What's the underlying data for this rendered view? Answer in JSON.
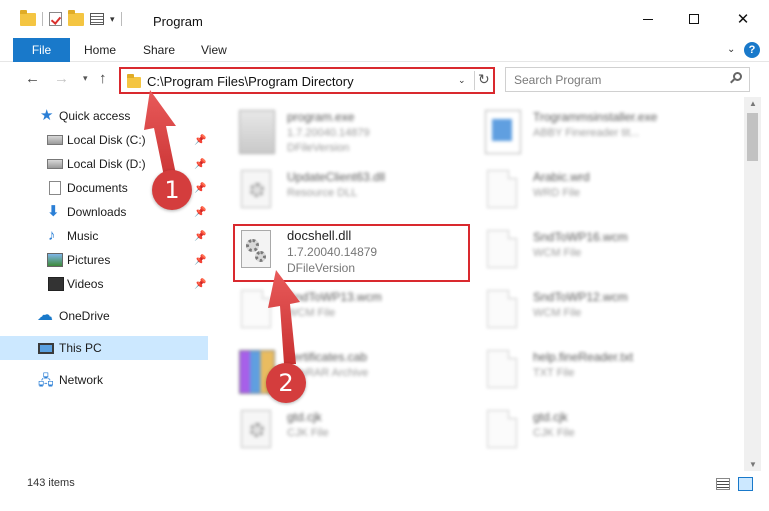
{
  "window": {
    "title": "Program",
    "minimize_label": "",
    "close_glyph": "✕"
  },
  "ribbon": {
    "tabs": [
      "File",
      "Home",
      "Share",
      "View"
    ],
    "help_label": "?",
    "expand_glyph": "⌄"
  },
  "nav": {
    "back_glyph": "←",
    "forward_glyph": "→",
    "recent_glyph": "▾",
    "up_glyph": "↑",
    "address": "C:\\Program Files\\Program Directory",
    "address_dropdown_glyph": "⌄",
    "refresh_glyph": "↻",
    "search_placeholder": "Search Program"
  },
  "sidebar": {
    "items": [
      {
        "label": "Quick access",
        "icon": "star-icon",
        "pinned": false
      },
      {
        "label": "Local Disk (C:)",
        "icon": "drive-icon",
        "pinned": true
      },
      {
        "label": "Local Disk (D:)",
        "icon": "drive-icon",
        "pinned": true
      },
      {
        "label": "Documents",
        "icon": "documents-icon",
        "pinned": true
      },
      {
        "label": "Downloads",
        "icon": "download-icon",
        "pinned": true
      },
      {
        "label": "Music",
        "icon": "music-icon",
        "pinned": true
      },
      {
        "label": "Pictures",
        "icon": "pictures-icon",
        "pinned": true
      },
      {
        "label": "Videos",
        "icon": "videos-icon",
        "pinned": true
      },
      {
        "label": "OneDrive",
        "icon": "cloud-icon",
        "pinned": false
      },
      {
        "label": "This PC",
        "icon": "computer-icon",
        "pinned": false,
        "selected": true
      },
      {
        "label": "Network",
        "icon": "network-icon",
        "pinned": false
      }
    ],
    "pin_glyph": "📌"
  },
  "files": [
    {
      "name": "program.exe",
      "line2": "1.7.20040.14879",
      "line3": "DFileVersion",
      "icon": "exe-icon",
      "blurred": true
    },
    {
      "name": "Trogrammsinstaller.exe",
      "line2": "ABBY Finereader tit...",
      "line3": "",
      "icon": "installer-icon",
      "blurred": true
    },
    {
      "name": "UpdateClient63.dll",
      "line2": "Resource DLL",
      "line3": "",
      "icon": "dll-icon",
      "blurred": true
    },
    {
      "name": "Arabic.wrd",
      "line2": "WRD File",
      "line3": "",
      "icon": "file-icon",
      "blurred": true
    },
    {
      "name": "docshell.dll",
      "line2": "1.7.20040.14879",
      "line3": "DFileVersion",
      "icon": "dll-icon",
      "blurred": false
    },
    {
      "name": "SndToWP16.wcm",
      "line2": "WCM File",
      "line3": "",
      "icon": "file-icon",
      "blurred": true
    },
    {
      "name": "SndToWP13.wcm",
      "line2": "WCM File",
      "line3": "",
      "icon": "file-icon",
      "blurred": true
    },
    {
      "name": "SndToWP12.wcm",
      "line2": "WCM File",
      "line3": "",
      "icon": "file-icon",
      "blurred": true
    },
    {
      "name": "certificates.cab",
      "line2": "WinRAR Archive",
      "line3": "",
      "icon": "archive-icon",
      "blurred": true
    },
    {
      "name": "help.fineReader.txt",
      "line2": "TXT File",
      "line3": "",
      "icon": "file-icon",
      "blurred": true
    },
    {
      "name": "gtd.cjk",
      "line2": "CJK File",
      "line3": "",
      "icon": "dll-icon",
      "blurred": true
    },
    {
      "name": "gtd.cjk",
      "line2": "CJK File",
      "line3": "",
      "icon": "file-icon",
      "blurred": true
    }
  ],
  "status": {
    "item_count": "143 items"
  },
  "annotations": {
    "step1": "1",
    "step2": "2"
  },
  "colors": {
    "accent": "#1979ca",
    "annotation_red": "#d9292e",
    "selected_bg": "#cce8ff"
  }
}
